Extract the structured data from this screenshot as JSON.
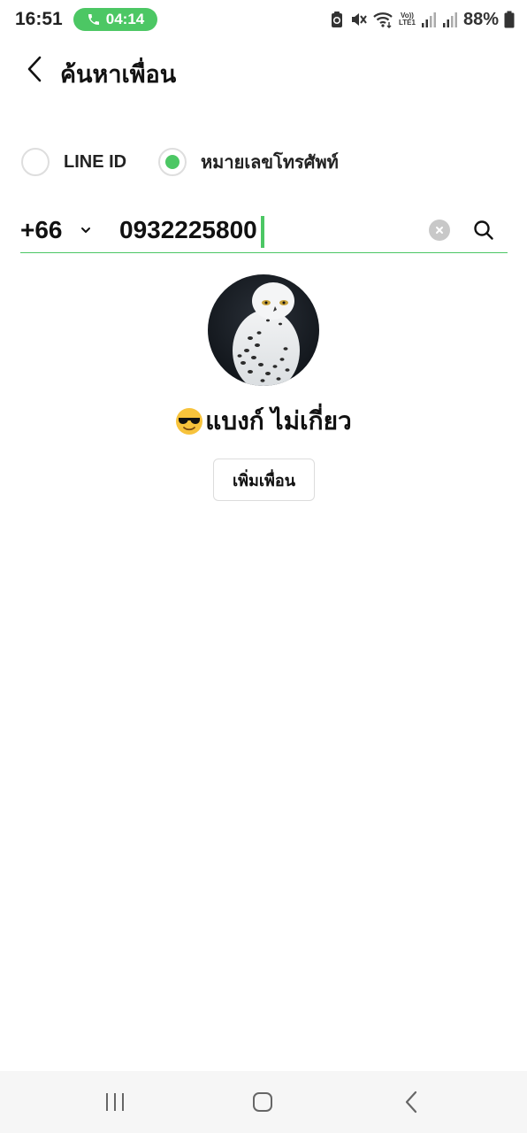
{
  "status_bar": {
    "time": "16:51",
    "call_duration": "04:14",
    "lte_top": "Vo))",
    "lte_bottom": "LTE1",
    "battery_percent": "88%"
  },
  "header": {
    "title": "ค้นหาเพื่อน"
  },
  "search_type": {
    "options": [
      {
        "label": "LINE ID",
        "selected": false
      },
      {
        "label": "หมายเลขโทรศัพท์",
        "selected": true
      }
    ]
  },
  "phone_search": {
    "country_code": "+66",
    "value": "0932225800"
  },
  "result": {
    "name": "แบงก์ ไม่เกี่ยว",
    "add_button_label": "เพิ่มเพื่อน"
  },
  "colors": {
    "accent": "#4cc764",
    "call_pill": "#4cc764",
    "nav_bar": "#f6f6f6"
  },
  "icons": {
    "call": "phone-icon",
    "sync": "sync-icon",
    "mute": "mute-icon",
    "wifi": "wifi-icon",
    "signal": "signal-icon",
    "battery": "battery-icon",
    "back": "back-arrow-icon",
    "chevron": "chevron-down-icon",
    "clear": "clear-icon",
    "search": "search-icon",
    "nav_recents": "recents-icon",
    "nav_home": "home-icon",
    "nav_back": "nav-back-icon"
  }
}
